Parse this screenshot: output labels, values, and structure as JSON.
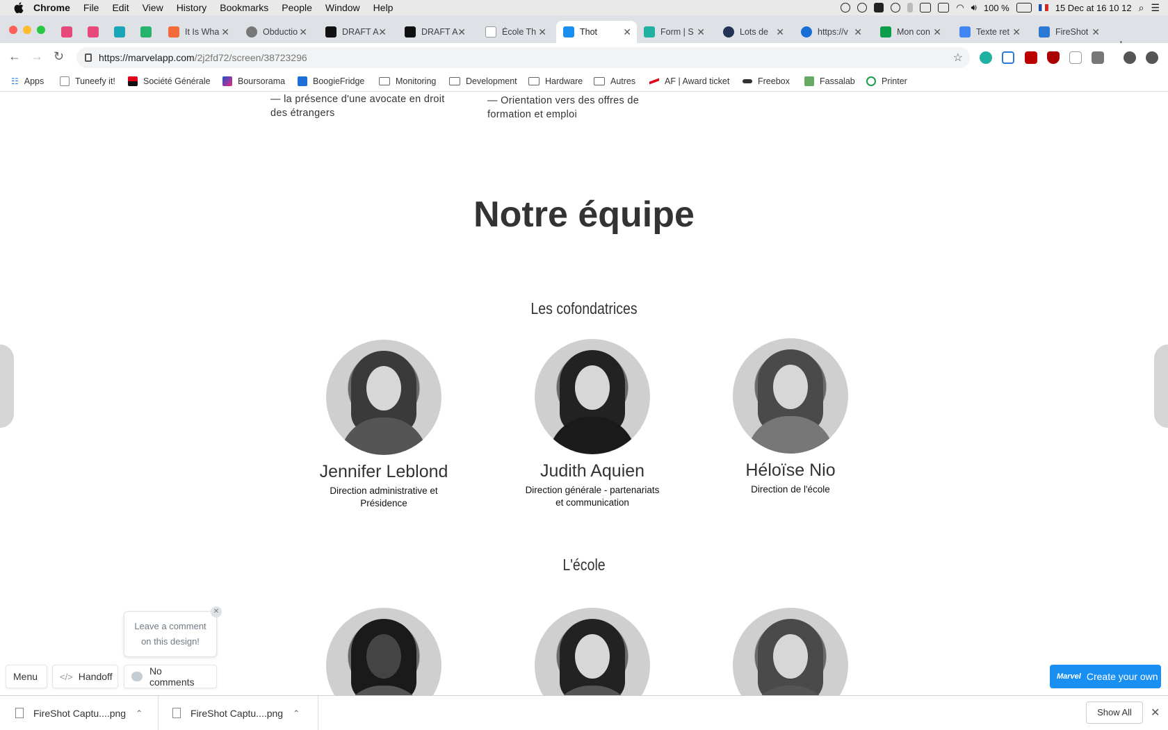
{
  "menubar": {
    "items": [
      "Chrome",
      "File",
      "Edit",
      "View",
      "History",
      "Bookmarks",
      "People",
      "Window",
      "Help"
    ],
    "battery": "100 %",
    "datetime": "15 Dec at 16 10 12"
  },
  "tabs": [
    {
      "title": "",
      "color": "#e8497b"
    },
    {
      "title": "",
      "color": "#e8497b"
    },
    {
      "title": "",
      "color": "#1aa6b7"
    },
    {
      "title": "",
      "color": "#26b36b"
    },
    {
      "title": "It Is Wha",
      "color": "#f26b3a"
    },
    {
      "title": "Obductio",
      "color": "#777777"
    },
    {
      "title": "DRAFT A",
      "color": "#111111"
    },
    {
      "title": "DRAFT A",
      "color": "#111111"
    },
    {
      "title": "École Th",
      "color": "#999999"
    },
    {
      "title": "Thot",
      "color": "#1a8ff2"
    },
    {
      "title": "Form | S",
      "color": "#21b1a3"
    },
    {
      "title": "Lots de",
      "color": "#223355"
    },
    {
      "title": "https://v",
      "color": "#1a6fd6"
    },
    {
      "title": "Mon con",
      "color": "#0a9e4a"
    },
    {
      "title": "Texte ret",
      "color": "#4285f4"
    },
    {
      "title": "FireShot",
      "color": "#2a7ad5"
    }
  ],
  "url": {
    "host": "https://marvelapp.com",
    "path": "/2j2fd72/screen/38723296"
  },
  "bookmarks": [
    {
      "label": "Apps",
      "icon": "apps-grid-icon"
    },
    {
      "label": "Tuneefy it!",
      "icon": "page-icon"
    },
    {
      "label": "Société Générale",
      "icon": "sg-icon"
    },
    {
      "label": "Boursorama",
      "icon": "boursorama-icon"
    },
    {
      "label": "BoogieFridge",
      "icon": "dsm-icon"
    },
    {
      "label": "Monitoring",
      "icon": "folder-icon"
    },
    {
      "label": "Development",
      "icon": "folder-icon"
    },
    {
      "label": "Hardware",
      "icon": "folder-icon"
    },
    {
      "label": "Autres",
      "icon": "folder-icon"
    },
    {
      "label": "AF | Award ticket",
      "icon": "airfrance-icon"
    },
    {
      "label": "Freebox",
      "icon": "freebox-icon"
    },
    {
      "label": "Fassalab",
      "icon": "fassalab-icon"
    },
    {
      "label": "Printer",
      "icon": "printer-icon"
    }
  ],
  "page": {
    "top_left_text": [
      "— la présence d'une avocate en droit",
      "des étrangers"
    ],
    "top_right_text": [
      "— Orientation vers des offres de",
      "formation et emploi"
    ],
    "team_title": "Notre équipe",
    "cofounders_title": "Les cofondatrices",
    "school_title": "L'école",
    "cofounders": [
      {
        "name": "Jennifer Leblond",
        "role_lines": [
          "Direction administrative et",
          "Présidence"
        ]
      },
      {
        "name": "Judith Aquien",
        "role_lines": [
          "Direction générale - partenariats",
          "et communication"
        ]
      },
      {
        "name": "Héloïse Nio",
        "role_lines": [
          "Direction de l'école"
        ]
      }
    ]
  },
  "marvel": {
    "comment_prompt_lines": [
      "Leave a comment",
      "on this design!"
    ],
    "menu_label": "Menu",
    "handoff_label": "Handoff",
    "comments_label": "No comments",
    "create_label": "Create your own",
    "logo_text": "Marvel"
  },
  "downloads": {
    "items": [
      "FireShot Captu....png",
      "FireShot Captu....png"
    ],
    "show_all": "Show All"
  }
}
